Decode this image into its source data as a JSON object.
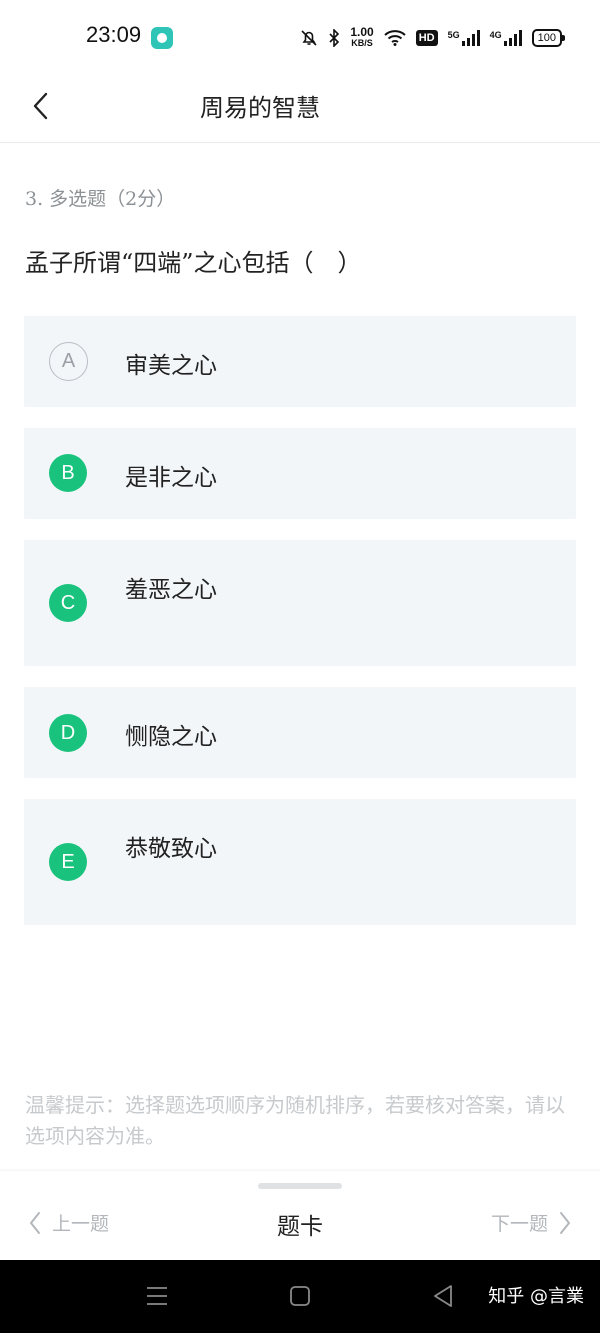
{
  "status_bar": {
    "time": "23:09",
    "net_speed_value": "1.00",
    "net_speed_unit": "KB/S",
    "hd_label": "HD",
    "sim1_label": "5G",
    "sim2_label": "4G",
    "battery": "100"
  },
  "header": {
    "title": "周易的智慧"
  },
  "question": {
    "type_label": "3. 多选题（2分）",
    "text": "孟子所谓“四端”之心包括（　）",
    "options": [
      {
        "letter": "A",
        "text": "审美之心",
        "selected": false
      },
      {
        "letter": "B",
        "text": "是非之心",
        "selected": true
      },
      {
        "letter": "C",
        "text": "羞恶之心",
        "selected": true
      },
      {
        "letter": "D",
        "text": "恻隐之心",
        "selected": true
      },
      {
        "letter": "E",
        "text": "恭敬致心",
        "selected": true
      }
    ]
  },
  "tip": "温馨提示：选择题选项顺序为随机排序，若要核对答案，请以选项内容为准。",
  "bottom_bar": {
    "prev_label": "上一题",
    "card_label": "题卡",
    "next_label": "下一题"
  },
  "watermark": "知乎 @言業",
  "colors": {
    "accent": "#19c37d",
    "option_bg": "#f3f6f9",
    "muted_text": "#8c9196"
  }
}
